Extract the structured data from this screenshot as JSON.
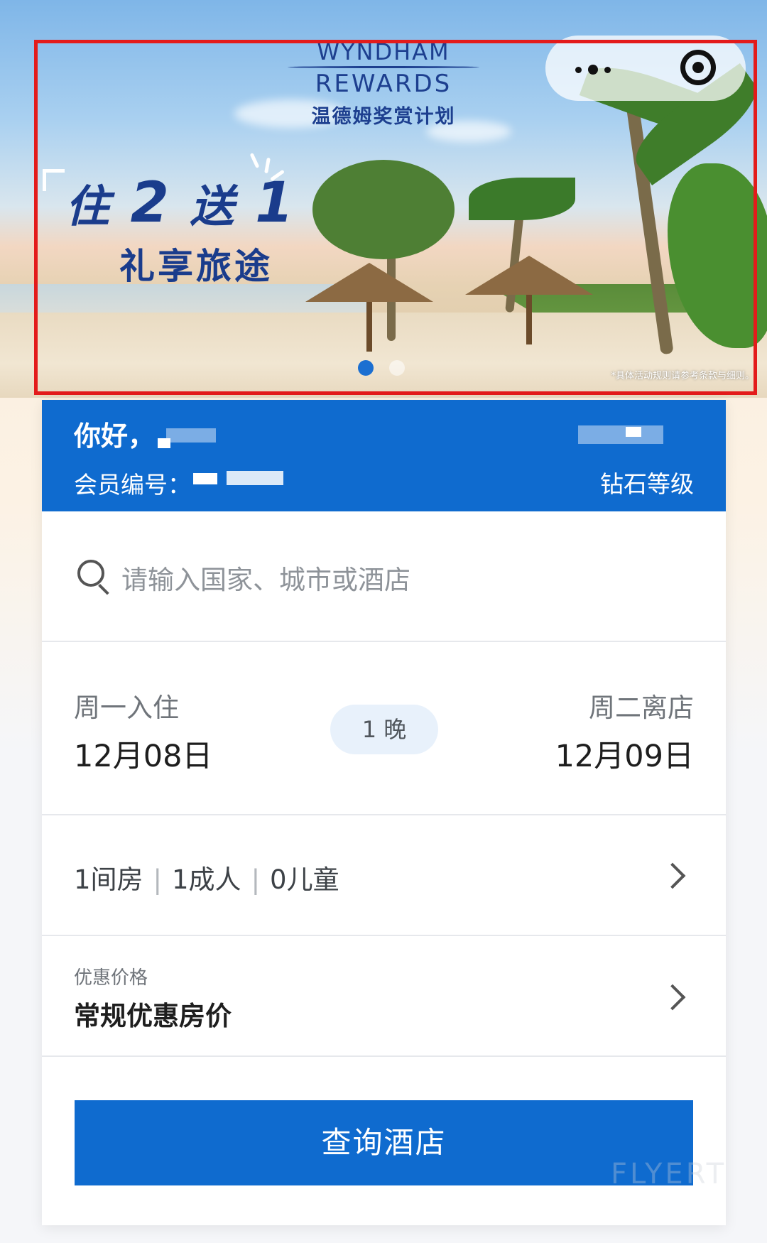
{
  "banner": {
    "brand_line1": "WYNDHAM",
    "brand_line2": "REWARDS",
    "brand_cn": "温德姆奖赏计划",
    "promo_part1": "住",
    "promo_num1": "2",
    "promo_part2": "送",
    "promo_num2": "1",
    "promo_line2": "礼享旅途",
    "terms": "*具体活动规则请参考条款与细则。",
    "slides_total": 2,
    "slide_active": 1
  },
  "member": {
    "greeting": "你好，",
    "member_no_label": "会员编号：",
    "tier": "钻石等级"
  },
  "search": {
    "placeholder": "请输入国家、城市或酒店"
  },
  "dates": {
    "checkin_label": "周一入住",
    "checkin_date": "12月08日",
    "nights": "1 晚",
    "checkout_label": "周二离店",
    "checkout_date": "12月09日"
  },
  "guests": {
    "rooms": "1间房",
    "adults": "1成人",
    "children": "0儿童",
    "separator": "|"
  },
  "rate": {
    "label": "优惠价格",
    "value": "常规优惠房价"
  },
  "button": {
    "search_label": "查询酒店"
  },
  "colors": {
    "primary_blue": "#0f6bcf",
    "annotation_red": "#e31b1b"
  },
  "icons": {
    "more": "more-icon",
    "close": "target-icon",
    "search": "search-icon",
    "chevron": "chevron-right-icon"
  }
}
